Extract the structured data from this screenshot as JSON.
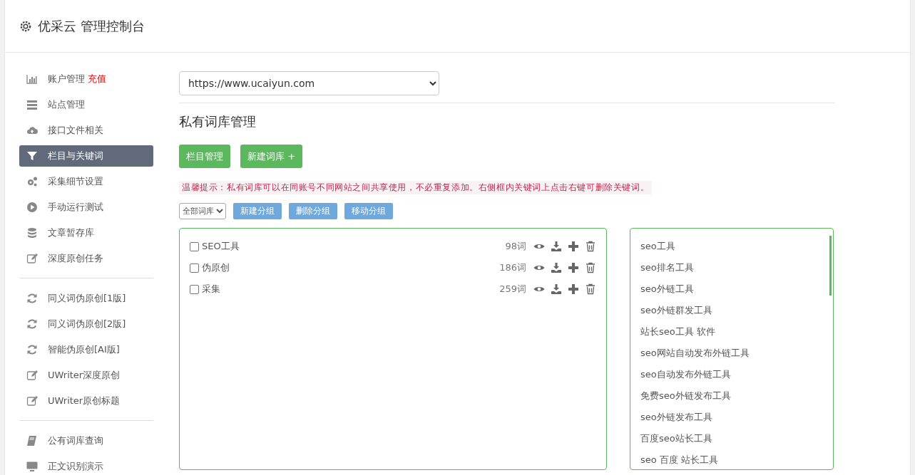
{
  "header": {
    "title": "优采云 管理控制台"
  },
  "sidebar": {
    "groups": [
      [
        {
          "label": "账户管理",
          "badge": "充值",
          "kind": "chart",
          "selected": false
        },
        {
          "label": "站点管理",
          "kind": "server",
          "selected": false
        },
        {
          "label": "接口文件相关",
          "kind": "cloud",
          "selected": false
        },
        {
          "label": "栏目与关键词",
          "kind": "filter",
          "selected": true
        },
        {
          "label": "采集细节设置",
          "kind": "gears",
          "selected": false
        },
        {
          "label": "手动运行测试",
          "kind": "play",
          "selected": false
        },
        {
          "label": "文章暂存库",
          "kind": "database",
          "selected": false
        },
        {
          "label": "深度原创任务",
          "kind": "edit",
          "selected": false
        }
      ],
      [
        {
          "label": "同义词伪原创[1版]",
          "kind": "refresh",
          "selected": false
        },
        {
          "label": "同义词伪原创[2版]",
          "kind": "refresh",
          "selected": false
        },
        {
          "label": "智能伪原创[AI版]",
          "kind": "refresh",
          "selected": false
        },
        {
          "label": "UWriter深度原创",
          "kind": "edit",
          "selected": false
        },
        {
          "label": "UWriter原创标题",
          "kind": "edit",
          "selected": false
        }
      ],
      [
        {
          "label": "公有词库查询",
          "kind": "book",
          "selected": false
        },
        {
          "label": "正文识别演示",
          "kind": "monitor",
          "selected": false
        }
      ]
    ]
  },
  "site_select": {
    "value": "https://www.ucaiyun.com"
  },
  "heading": "私有词库管理",
  "actions": [
    "栏目管理",
    "新建词库 +"
  ],
  "tip": "温馨提示：私有词库可以在同账号不同网站之间共享使用，不必重复添加。右侧框内关键词上点击右键可删除关键词。",
  "group_select": {
    "value": "全部词库"
  },
  "group_buttons": [
    "新建分组",
    "删除分组",
    "移动分组"
  ],
  "libraries": [
    {
      "name": "SEO工具",
      "count": "98词",
      "checked": false
    },
    {
      "name": "伪原创",
      "count": "186词",
      "checked": false
    },
    {
      "name": "采集",
      "count": "259词",
      "checked": false
    }
  ],
  "keywords": [
    "seo工具",
    "seo排名工具",
    "seo外链工具",
    "seo外链群发工具",
    "站长seo工具 软件",
    "seo网站自动发布外链工具",
    "seo自动发布外链工具",
    "免费seo外链发布工具",
    "seo外链发布工具",
    "百度seo站长工具",
    "seo 百度 站长工具"
  ]
}
